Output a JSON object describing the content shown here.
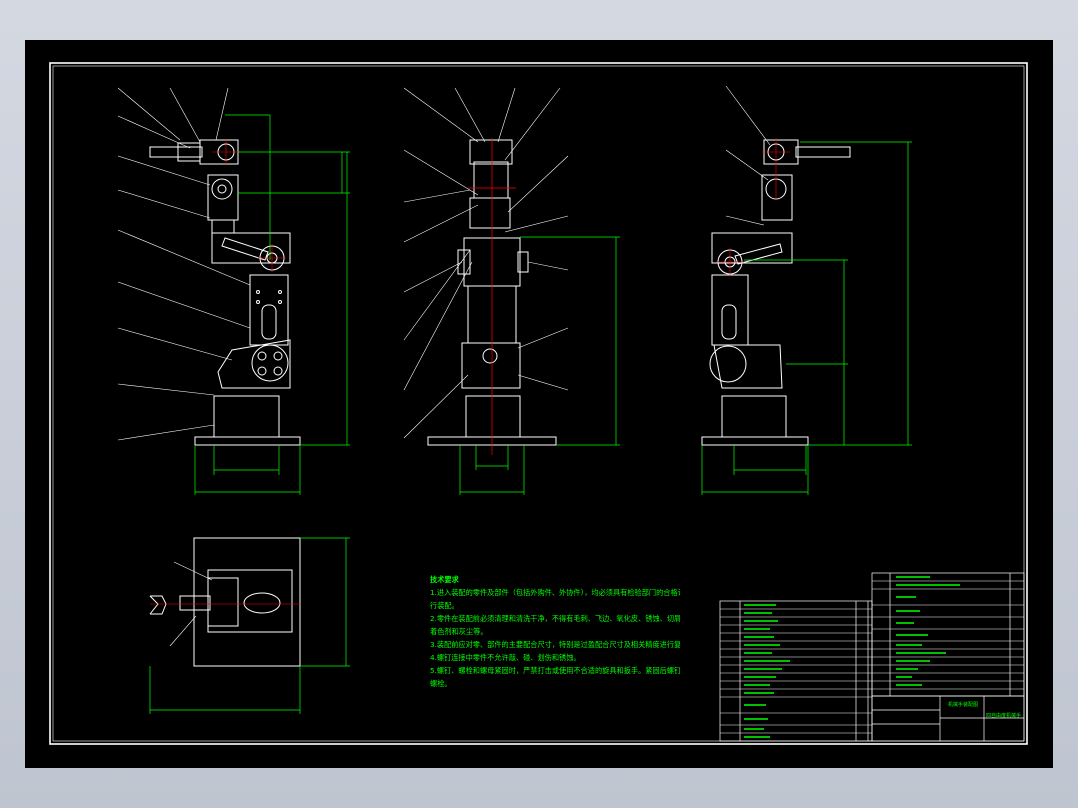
{
  "notes": {
    "title": "技术要求",
    "lines": [
      "1.进入装配的零件及部件（包括外购件、外协件），均必须具有检验部门的合格证方能进",
      "行装配。",
      "2.零件在装配前必须清理和清洗干净，不得有毛刺、飞边、氧化皮、锈蚀、切屑、油污、",
      "着色剂和灰尘等。",
      "3.装配前应对零、部件的主要配合尺寸，特别是过盈配合尺寸及相关精度进行复查。",
      "4.螺钉连接中零件不允许敲、碰、划伤和锈蚀。",
      "5.螺钉、螺栓和螺母紧固时，严禁打击或使用不合适的旋具和扳手。紧固后螺钉槽、螺母",
      "螺栓。"
    ]
  },
  "title_block": {
    "drawing_title": "机械手装配图",
    "company": "四自由度机械手"
  },
  "colors": {
    "sheet": "#000000",
    "lines": "#ffffff",
    "dimensions": "#00ff00",
    "centerlines": "#ff0000",
    "leaders": "#ffffff"
  }
}
